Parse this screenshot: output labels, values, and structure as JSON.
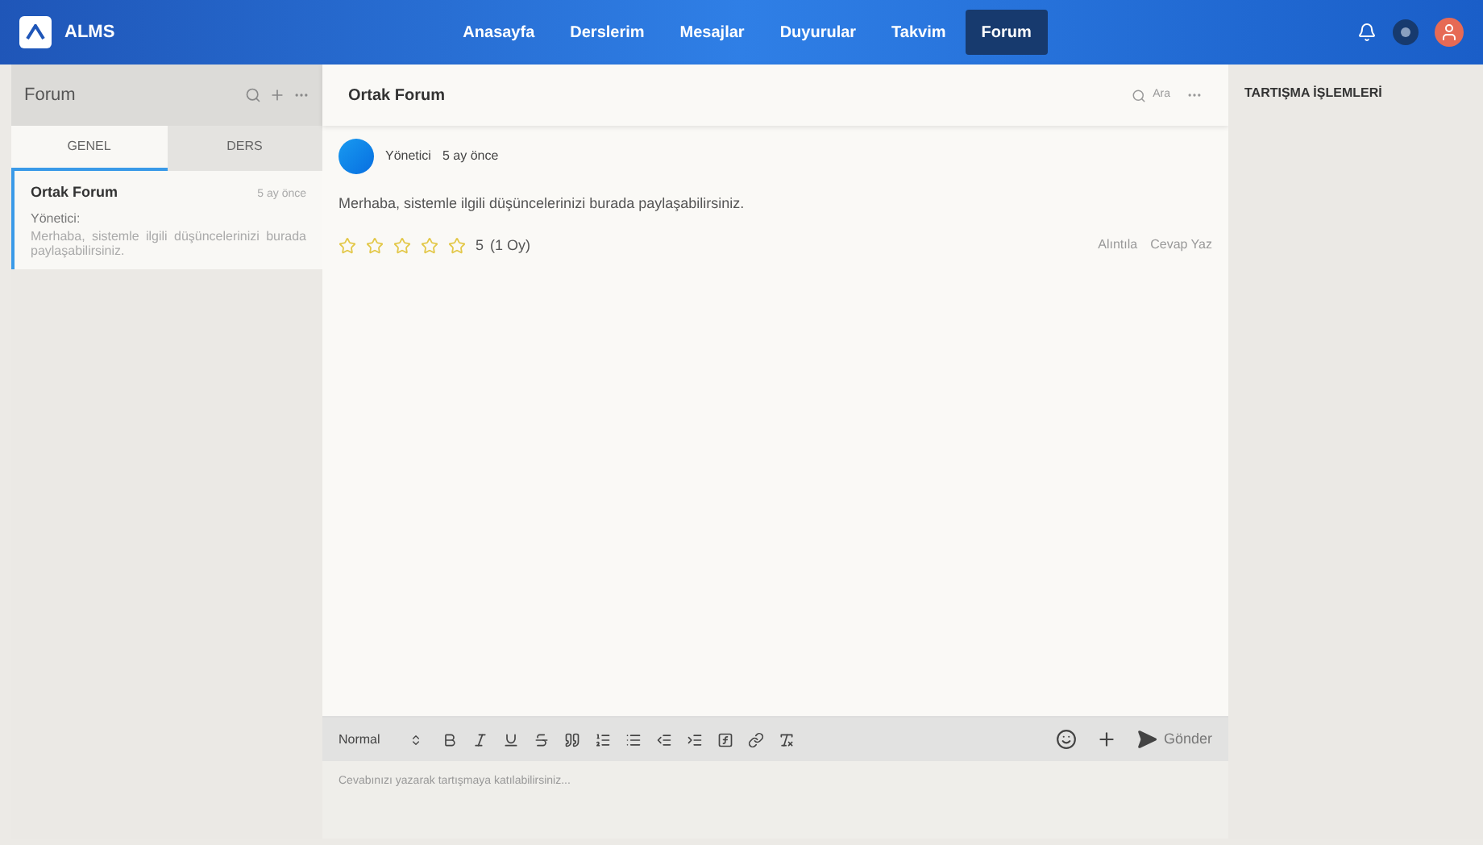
{
  "app": {
    "logo": "ALMS"
  },
  "nav": [
    {
      "label": "Anasayfa",
      "selected": false
    },
    {
      "label": "Derslerim",
      "selected": false
    },
    {
      "label": "Mesajlar",
      "selected": false
    },
    {
      "label": "Duyurular",
      "selected": false
    },
    {
      "label": "Takvim",
      "selected": false
    },
    {
      "label": "Forum",
      "selected": true
    }
  ],
  "sidebar": {
    "title": "Forum",
    "tabs": [
      {
        "label": "GENEL",
        "selected": true
      },
      {
        "label": "DERS",
        "selected": false
      }
    ],
    "items": [
      {
        "title": "Ortak Forum",
        "time": "5 ay önce",
        "author": "Yönetici:",
        "preview": "Merhaba, sistemle ilgili düşüncelerinizi burada paylaşabilirsiniz.",
        "selected": true
      }
    ]
  },
  "thread": {
    "title": "Ortak Forum",
    "search": "Ara",
    "posts": [
      {
        "author": "Yönetici",
        "time": "5 ay önce",
        "body": "Merhaba, sistemle ilgili düşüncelerinizi burada paylaşabilirsiniz.",
        "stars": 0,
        "score": "5",
        "votes": "(1 Oy)",
        "actions": [
          "Alıntıla",
          "Cevap Yaz"
        ]
      }
    ],
    "editor": {
      "format": "Normal",
      "send": "Gönder",
      "placeholder": "Cevabınızı yazarak tartışmaya katılabilirsiniz..."
    }
  },
  "right_panel": {
    "title": "TARTIŞMA İŞLEMLERİ"
  }
}
